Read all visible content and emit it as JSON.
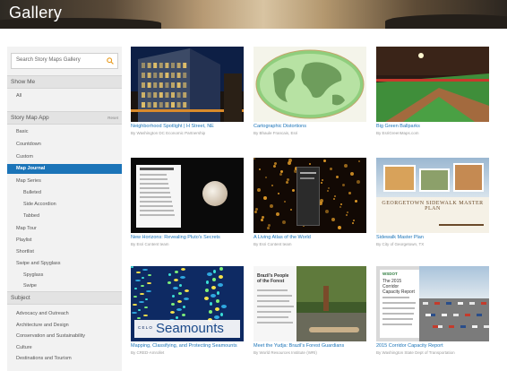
{
  "header": {
    "title": "Gallery"
  },
  "sidebar": {
    "search_placeholder": "Search Story Maps Gallery",
    "show_me": {
      "title": "Show Me",
      "items": [
        "All"
      ]
    },
    "story_map_app": {
      "title": "Story Map App",
      "action": "Reset",
      "items": [
        {
          "label": "Basic",
          "level": 0,
          "selected": false
        },
        {
          "label": "Countdown",
          "level": 0,
          "selected": false
        },
        {
          "label": "Custom",
          "level": 0,
          "selected": false
        },
        {
          "label": "Map Journal",
          "level": 0,
          "selected": true
        },
        {
          "label": "Map Series",
          "level": 0,
          "selected": false
        },
        {
          "label": "Bulleted",
          "level": 1,
          "selected": false
        },
        {
          "label": "Side Accordion",
          "level": 1,
          "selected": false
        },
        {
          "label": "Tabbed",
          "level": 1,
          "selected": false
        },
        {
          "label": "Map Tour",
          "level": 0,
          "selected": false
        },
        {
          "label": "Playlist",
          "level": 0,
          "selected": false
        },
        {
          "label": "Shortlist",
          "level": 0,
          "selected": false
        },
        {
          "label": "Swipe and Spyglass",
          "level": 0,
          "selected": false
        },
        {
          "label": "Spyglass",
          "level": 1,
          "selected": false
        },
        {
          "label": "Swipe",
          "level": 1,
          "selected": false
        }
      ]
    },
    "subject": {
      "title": "Subject",
      "items": [
        "Advocacy and Outreach",
        "Architecture and Design",
        "Conservation and Sustainability",
        "Culture",
        "Destinations and Tourism"
      ]
    }
  },
  "gallery": {
    "cards": [
      {
        "title": "Neighborhood Spotlight | H Street, NE",
        "author": "By Washington DC Economic Partnership",
        "thumb": "city-night"
      },
      {
        "title": "Cartographic Distortions",
        "author": "By Bhaule Francais, Esri",
        "thumb": "world-map"
      },
      {
        "title": "Big Green Ballparks",
        "author": "By EsriGreenMaps.com",
        "thumb": "ballpark"
      },
      {
        "title": "New Horizons: Revealing Pluto's Secrets",
        "author": "By Esri Content team",
        "thumb": "pluto"
      },
      {
        "title": "A Living Atlas of the World",
        "author": "By Esri Content team",
        "thumb": "atlas"
      },
      {
        "title": "Sidewalk Master Plan",
        "author": "By City of Georgetown, TX",
        "thumb": "sidewalk",
        "overlay_text": "GEORGETOWN SIDEWALK MASTER PLAN"
      },
      {
        "title": "Mapping, Classifying, and Protecting Seamounts",
        "author": "By CRED-Amrollet",
        "thumb": "seamounts",
        "overlay_text": "Seamounts",
        "overlay_small": "C E L O"
      },
      {
        "title": "Meet the Yudja: Brazil's Forest Guardians",
        "author": "By World Resources Institute (WRI)",
        "thumb": "yudja",
        "overlay_text": "Brazil's People of the Forest"
      },
      {
        "title": "2015 Corridor Capacity Report",
        "author": "By Washington State Dept of Transportation",
        "thumb": "corridor",
        "overlay_text": "The 2015 Corridor Capacity Report",
        "overlay_small": "WSDOT"
      }
    ]
  },
  "colors": {
    "accent": "#1b74b8",
    "selected_bg": "#1b74b8",
    "sidebar_bg": "#f2f2f2"
  }
}
